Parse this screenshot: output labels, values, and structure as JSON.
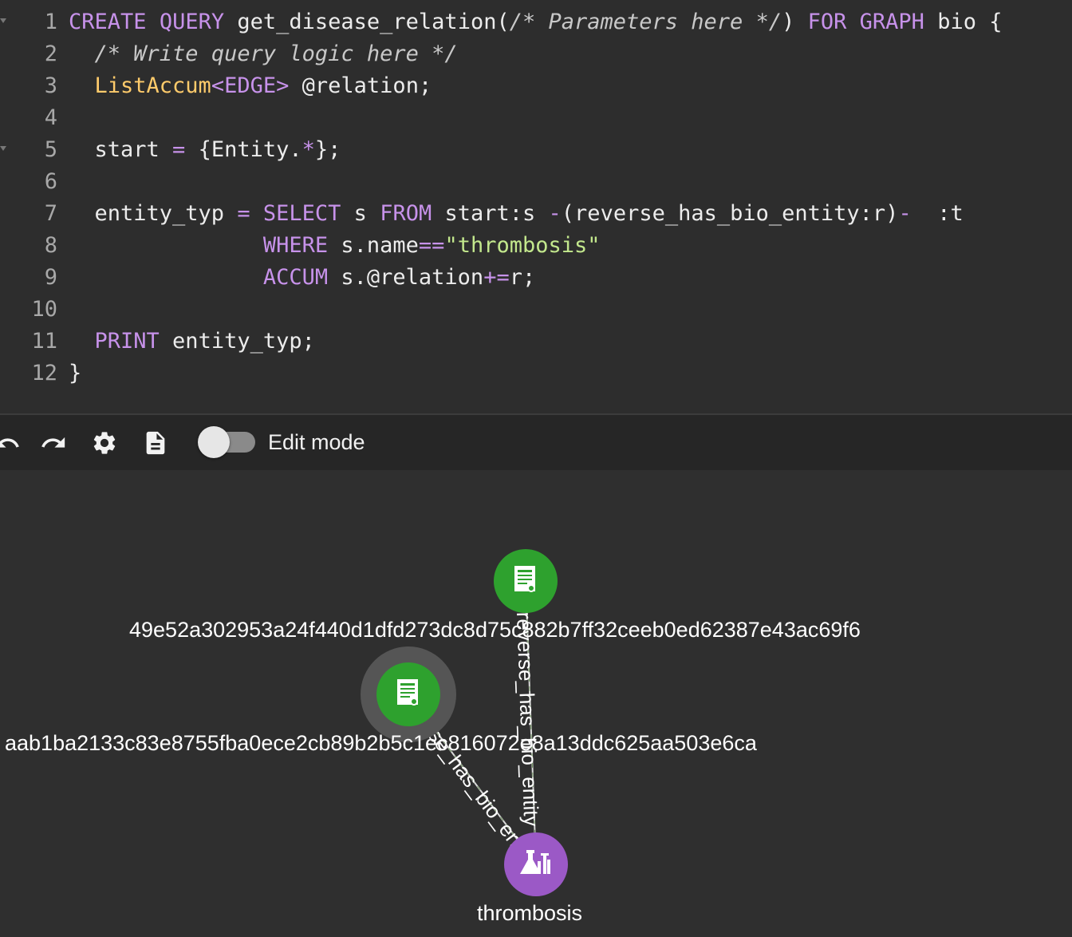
{
  "editor": {
    "lines": [
      {
        "num": "1",
        "tokens": [
          [
            "kw",
            "CREATE"
          ],
          [
            "",
            "&nbsp;"
          ],
          [
            "kw",
            "QUERY"
          ],
          [
            "",
            "&nbsp;get_disease_relation("
          ],
          [
            "cm",
            "/* Parameters here */"
          ],
          [
            "",
            ")&nbsp;"
          ],
          [
            "kw",
            "FOR"
          ],
          [
            "",
            "&nbsp;"
          ],
          [
            "kw",
            "GRAPH"
          ],
          [
            "",
            "&nbsp;bio {"
          ]
        ]
      },
      {
        "num": "2",
        "tokens": [
          [
            "",
            "&nbsp;&nbsp;"
          ],
          [
            "cm",
            "/* Write query logic here */"
          ]
        ]
      },
      {
        "num": "3",
        "tokens": [
          [
            "",
            "&nbsp;&nbsp;"
          ],
          [
            "ty",
            "ListAccum"
          ],
          [
            "op",
            "&lt;"
          ],
          [
            "kw",
            "EDGE"
          ],
          [
            "op",
            "&gt;"
          ],
          [
            "",
            "&nbsp;@relation;"
          ]
        ]
      },
      {
        "num": "4",
        "tokens": []
      },
      {
        "num": "5",
        "tokens": [
          [
            "",
            "&nbsp;&nbsp;start&nbsp;"
          ],
          [
            "op",
            "="
          ],
          [
            "",
            "&nbsp;{Entity."
          ],
          [
            "op",
            "*"
          ],
          [
            "",
            "};"
          ]
        ]
      },
      {
        "num": "6",
        "tokens": []
      },
      {
        "num": "7",
        "tokens": [
          [
            "",
            "&nbsp;&nbsp;entity_typ&nbsp;"
          ],
          [
            "op",
            "="
          ],
          [
            "",
            "&nbsp;"
          ],
          [
            "kw",
            "SELECT"
          ],
          [
            "",
            "&nbsp;s&nbsp;"
          ],
          [
            "kw",
            "FROM"
          ],
          [
            "",
            "&nbsp;start:s&nbsp;"
          ],
          [
            "op",
            "-"
          ],
          [
            "",
            "(reverse_has_bio_entity:r)"
          ],
          [
            "op",
            "-"
          ],
          [
            "",
            "&nbsp;&nbsp;:t"
          ]
        ]
      },
      {
        "num": "8",
        "tokens": [
          [
            "",
            "&nbsp;&nbsp;&nbsp;&nbsp;&nbsp;&nbsp;&nbsp;&nbsp;&nbsp;&nbsp;&nbsp;&nbsp;&nbsp;&nbsp;&nbsp;"
          ],
          [
            "kw",
            "WHERE"
          ],
          [
            "",
            "&nbsp;s.name"
          ],
          [
            "op",
            "=="
          ],
          [
            "str",
            "\"thrombosis\""
          ]
        ]
      },
      {
        "num": "9",
        "tokens": [
          [
            "",
            "&nbsp;&nbsp;&nbsp;&nbsp;&nbsp;&nbsp;&nbsp;&nbsp;&nbsp;&nbsp;&nbsp;&nbsp;&nbsp;&nbsp;&nbsp;"
          ],
          [
            "kw",
            "ACCUM"
          ],
          [
            "",
            "&nbsp;s.@relation"
          ],
          [
            "op",
            "+="
          ],
          [
            "",
            "r;"
          ]
        ]
      },
      {
        "num": "10",
        "tokens": []
      },
      {
        "num": "11",
        "tokens": [
          [
            "",
            "&nbsp;&nbsp;"
          ],
          [
            "kw",
            "PRINT"
          ],
          [
            "",
            "&nbsp;entity_typ;"
          ]
        ]
      },
      {
        "num": "12",
        "tokens": [
          [
            "",
            "}"
          ]
        ]
      }
    ],
    "fold_lines": [
      "1",
      "5"
    ]
  },
  "toolbar": {
    "icons": [
      "undo-icon",
      "redo-icon",
      "gear-icon",
      "document-icon"
    ],
    "edit_mode_label": "Edit mode",
    "edit_mode_on": false
  },
  "graph": {
    "nodes": [
      {
        "id": "doc1",
        "type": "document",
        "label": "49e52a302953a24f440d1dfd273dc8d75c882b7ff32ceeb0ed62387e43ac69f6",
        "color": "#2ea12e"
      },
      {
        "id": "doc2",
        "type": "document",
        "label": "aab1ba2133c83e8755fba0ece2cb89b2b5c1ec816072e8a13ddc625aa503e6ca",
        "color": "#2ea12e",
        "selected": true
      },
      {
        "id": "entity",
        "type": "entity",
        "label": "thrombosis",
        "color": "#9b59c6"
      }
    ],
    "edges": [
      {
        "from": "entity",
        "to": "doc1",
        "label": "reverse_has_bio_entity"
      },
      {
        "from": "entity",
        "to": "doc2",
        "label": "reverse_has_bio_entity"
      }
    ]
  }
}
